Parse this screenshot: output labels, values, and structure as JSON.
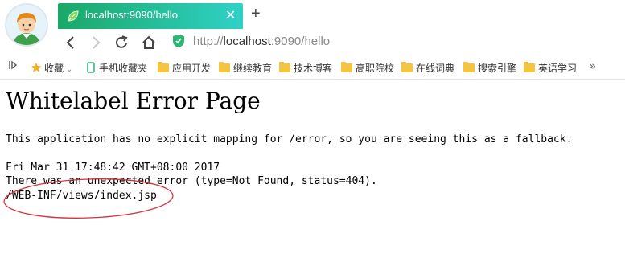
{
  "browser": {
    "tab": {
      "title": "localhost:9090/hello",
      "close_glyph": "✕",
      "icon": "spring-leaf-icon"
    },
    "new_tab_glyph": "+",
    "address": {
      "scheme": "http://",
      "host": "localhost",
      "rest": ":9090/hello"
    },
    "bookmarks": [
      {
        "label": "收藏",
        "icon": "star-icon"
      },
      {
        "label": "手机收藏夹",
        "icon": "phone-icon"
      },
      {
        "label": "应用开发",
        "icon": "folder-icon"
      },
      {
        "label": "继续教育",
        "icon": "folder-icon"
      },
      {
        "label": "技术博客",
        "icon": "folder-icon"
      },
      {
        "label": "高职院校",
        "icon": "folder-icon"
      },
      {
        "label": "在线词典",
        "icon": "folder-icon"
      },
      {
        "label": "搜索引擎",
        "icon": "folder-icon"
      },
      {
        "label": "英语学习",
        "icon": "folder-icon"
      }
    ],
    "more_glyph": "»",
    "colors": {
      "tab_start": "#1aa868",
      "tab_end": "#2fd2c7",
      "annotation": "#d9303a"
    }
  },
  "page": {
    "heading": "Whitelabel Error Page",
    "message": "This application has no explicit mapping for /error, so you are seeing this as a fallback.",
    "timestamp": "Fri Mar 31 17:48:42 GMT+08:00 2017",
    "error": "There was an unexpected error (type=Not Found, status=404).",
    "path": "/WEB-INF/views/index.jsp"
  }
}
